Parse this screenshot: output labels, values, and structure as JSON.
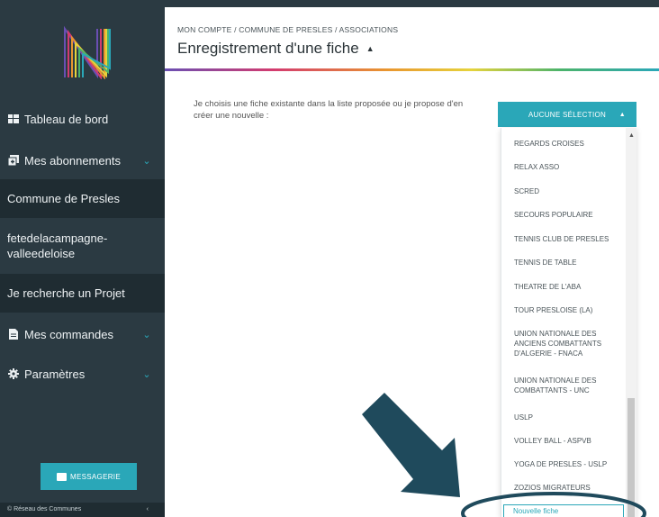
{
  "sidebar": {
    "logo_letter": "N",
    "items": [
      {
        "label": "Tableau de bord",
        "icon": "dashboard-icon",
        "chevron": false
      },
      {
        "label": "Mes abonnements",
        "icon": "subscriptions-icon",
        "chevron": true
      },
      {
        "label": "Mes commandes",
        "icon": "orders-icon",
        "chevron": true
      },
      {
        "label": "Paramètres",
        "icon": "gear-icon",
        "chevron": true
      }
    ],
    "subitems": [
      {
        "label": "Commune de Presles"
      },
      {
        "label": "fetedelacampagne-valleedeloise"
      },
      {
        "label": "Je recherche un Projet"
      }
    ],
    "messagerie_label": "MESSAGERIE",
    "footer_text": "© Réseau des Communes"
  },
  "header": {
    "breadcrumb": "MON COMPTE / COMMUNE DE PRESLES / ASSOCIATIONS",
    "title": "Enregistrement d'une fiche"
  },
  "main": {
    "prompt": "Je choisis une fiche existante dans la liste proposée ou je propose d'en créer une nouvelle :",
    "select_label": "AUCUNE SÉLECTION",
    "options": [
      "REGARDS CROISES",
      "RELAX ASSO",
      "SCRED",
      "SECOURS POPULAIRE",
      "TENNIS CLUB DE PRESLES",
      "TENNIS DE TABLE",
      "THEATRE DE L'ABA",
      "TOUR PRESLOISE (LA)",
      "UNION NATIONALE DES ANCIENS COMBATTANTS D'ALGERIE - FNACA",
      "UNION NATIONALE DES COMBATTANTS - UNC",
      "USLP",
      "VOLLEY BALL - ASPVB",
      "YOGA DE PRESLES - USLP",
      "ZOZIOS MIGRATEURS"
    ],
    "new_item_label": "Nouvelle fiche"
  },
  "colors": {
    "sidebar_bg": "#2b3a42",
    "sidebar_active": "#1f2c32",
    "accent": "#2aa7b8",
    "arrow": "#1f4a5c"
  }
}
